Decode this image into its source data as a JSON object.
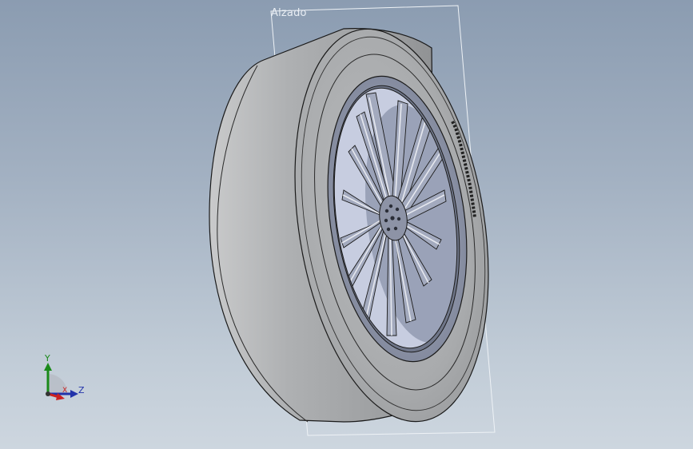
{
  "view": {
    "orientation_label": "Alzado"
  },
  "triad": {
    "y_label": "Y",
    "z_label": "Z",
    "x_label": "X",
    "colors": {
      "y": "#1a8a1a",
      "z": "#2233aa",
      "x": "#cc2222"
    }
  },
  "model": {
    "icon": "wheel-tire-model",
    "tire_color": "#a7a9ab",
    "rim_color": "#8c93a6"
  }
}
